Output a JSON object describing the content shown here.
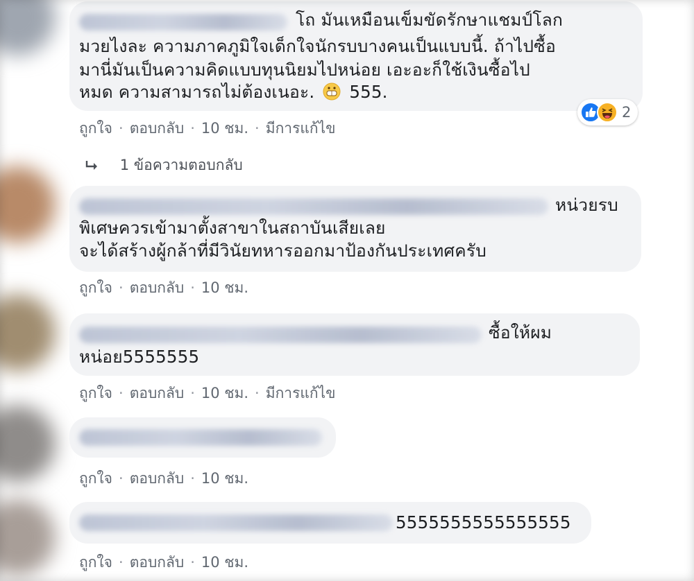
{
  "comments": [
    {
      "lines": [
        "โถ มันเหมือนเข็มขัดรักษาแชมป์โลก",
        "มวยไงละ ความภาคภูมิใจเด็กใจนักรบบางคนเป็นแบบนี้. ถ้าไปซื้อ",
        "มานี่มันเป็นความคิดแบบทุนนิยมไปหน่อย เอะอะก็ใช้เงินซื้อไป",
        "หมด ความสามารถไม่ต้องเนอะ.",
        "555."
      ],
      "like": "ถูกใจ",
      "reply": "ตอบกลับ",
      "time": "10 ชม.",
      "edited": "มีการแก้ไข",
      "reaction_count": "2"
    },
    {
      "lines": [
        "หน่วยรบ",
        "พิเศษควรเข้ามาตั้งสาขาในสถาบันเสียเลย",
        "จะได้สร้างผู้กล้าที่มีวินัยทหารออกมาป้องกันประเทศครับ"
      ],
      "like": "ถูกใจ",
      "reply": "ตอบกลับ",
      "time": "10 ชม."
    },
    {
      "lines": [
        "ซื้อให้ผม",
        "หน่อย5555555"
      ],
      "like": "ถูกใจ",
      "reply": "ตอบกลับ",
      "time": "10 ชม.",
      "edited": "มีการแก้ไข"
    },
    {
      "lines": [],
      "like": "ถูกใจ",
      "reply": "ตอบกลับ",
      "time": "10 ชม."
    },
    {
      "lines": [
        "5555555555555555"
      ],
      "like": "ถูกใจ",
      "reply": "ตอบกลับ",
      "time": "10 ชม."
    }
  ],
  "replies_link": "1 ข้อความตอบกลับ",
  "separator": "·",
  "colors": {
    "bubble": "#f2f3f5",
    "meta_text": "#606770",
    "like_blue": "#1877f2",
    "haha_yellow": "#f7b125"
  },
  "icons": {
    "reply_arrow": "reply-arrow-icon",
    "like_reaction": "like-reaction-icon",
    "haha_reaction": "haha-reaction-icon",
    "grin_emoji": "grinning-emoji-icon"
  }
}
